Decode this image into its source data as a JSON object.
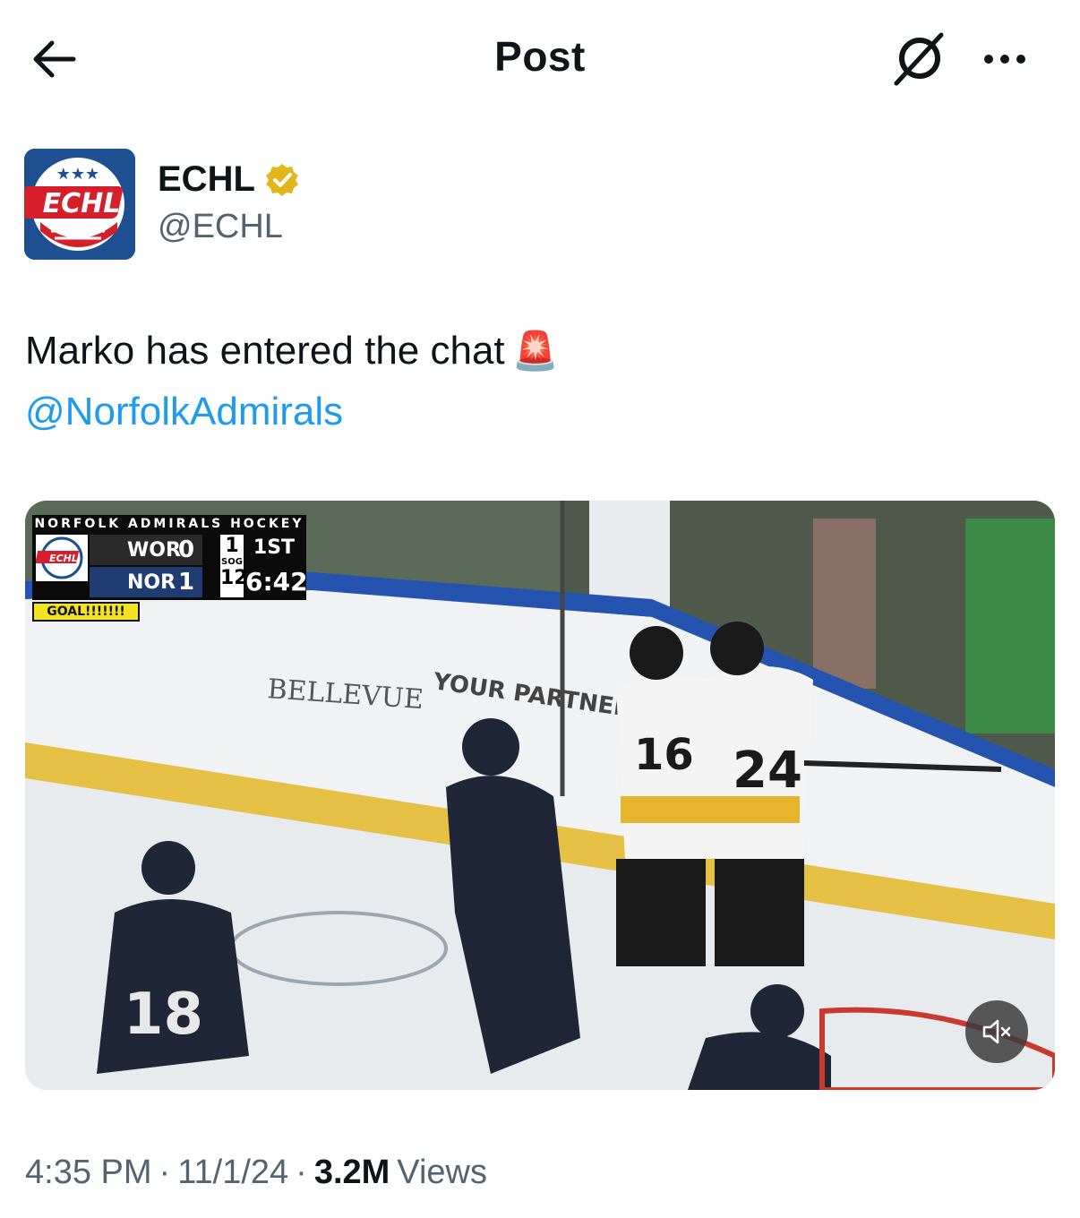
{
  "header": {
    "title": "Post",
    "back_icon": "arrow-left-icon",
    "grok_icon": "grok-icon",
    "more_icon": "more-horizontal-icon"
  },
  "author": {
    "name": "ECHL",
    "handle": "@ECHL",
    "verified": true,
    "verified_color": "#e2b719",
    "avatar_text": "ECHL"
  },
  "post": {
    "text": "Marko has entered the chat",
    "emoji": "🚨",
    "mention": "@NorfolkAdmirals"
  },
  "media": {
    "type": "video",
    "scorebug": {
      "title": "NORFOLK ADMIRALS HOCKEY",
      "team1": "WOR",
      "team1_score": "0",
      "team2": "NOR",
      "team2_score": "1",
      "sog_label": "SOG",
      "team1_sog": "1",
      "team2_sog": "12",
      "period": "1ST",
      "clock": "6:42",
      "banner": "GOAL!!!!!!!"
    },
    "mute_icon": "volume-muted-icon"
  },
  "meta": {
    "time": "4:35 PM",
    "separator": "·",
    "date": "11/1/24",
    "views_count": "3.2M",
    "views_label": "Views"
  },
  "colors": {
    "link": "#1d9bf0",
    "text": "#0f1419",
    "secondary": "#536471"
  }
}
